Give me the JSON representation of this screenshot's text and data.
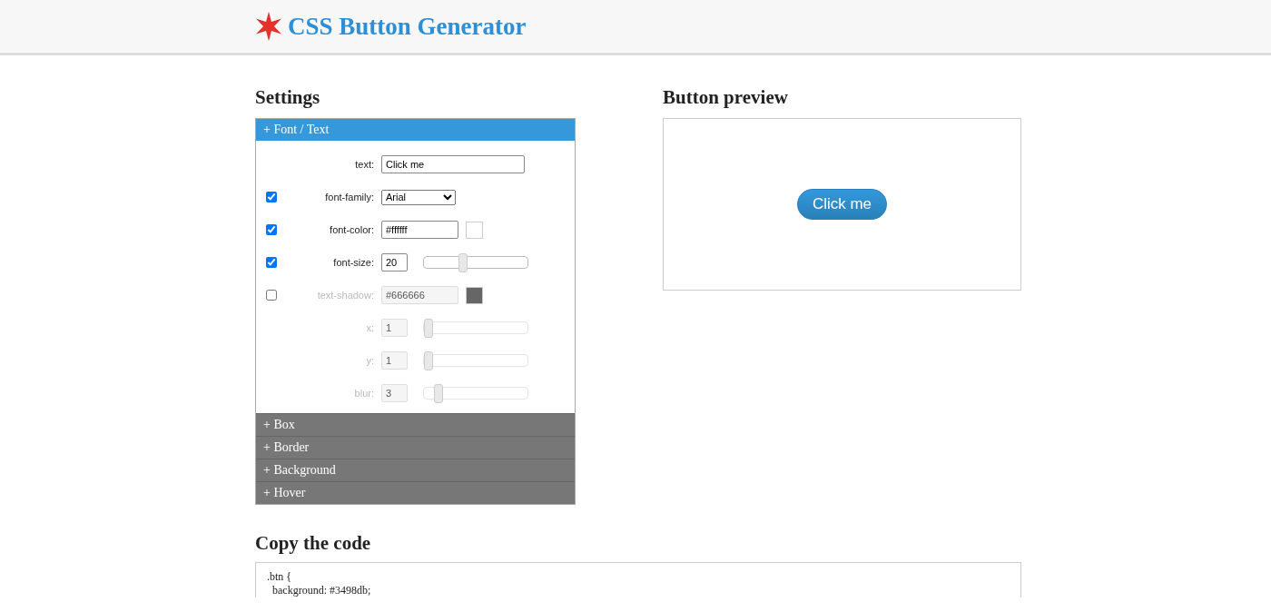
{
  "header": {
    "title": "CSS Button Generator"
  },
  "settings": {
    "heading": "Settings",
    "sections": [
      {
        "label": "+ Font / Text",
        "expanded": true,
        "rows": [
          {
            "kind": "text",
            "label": "text:",
            "value": "Click me",
            "disabled": false
          },
          {
            "kind": "select",
            "label": "font-family:",
            "value": "Arial",
            "checked": true,
            "disabled": false
          },
          {
            "kind": "color",
            "label": "font-color:",
            "value": "#ffffff",
            "checked": true,
            "disabled": false
          },
          {
            "kind": "range",
            "label": "font-size:",
            "value": "20",
            "level": 0.33,
            "checked": true,
            "disabled": false
          },
          {
            "kind": "color",
            "label": "text-shadow:",
            "value": "#666666",
            "checked": false,
            "disabled": true
          },
          {
            "kind": "range",
            "label": "x:",
            "value": "1",
            "level": 0,
            "disabled": true
          },
          {
            "kind": "range",
            "label": "y:",
            "value": "1",
            "level": 0,
            "disabled": true
          },
          {
            "kind": "range",
            "label": "blur:",
            "value": "3",
            "level": 0.1,
            "disabled": true
          }
        ]
      },
      {
        "label": "+ Box",
        "expanded": false
      },
      {
        "label": "+ Border",
        "expanded": false
      },
      {
        "label": "+ Background",
        "expanded": false
      },
      {
        "label": "+ Hover",
        "expanded": false
      }
    ]
  },
  "preview": {
    "heading": "Button preview",
    "button": "Click me"
  },
  "code": {
    "heading": "Copy the code",
    "lines": [
      ".btn {",
      "  background: #3498db;"
    ]
  }
}
